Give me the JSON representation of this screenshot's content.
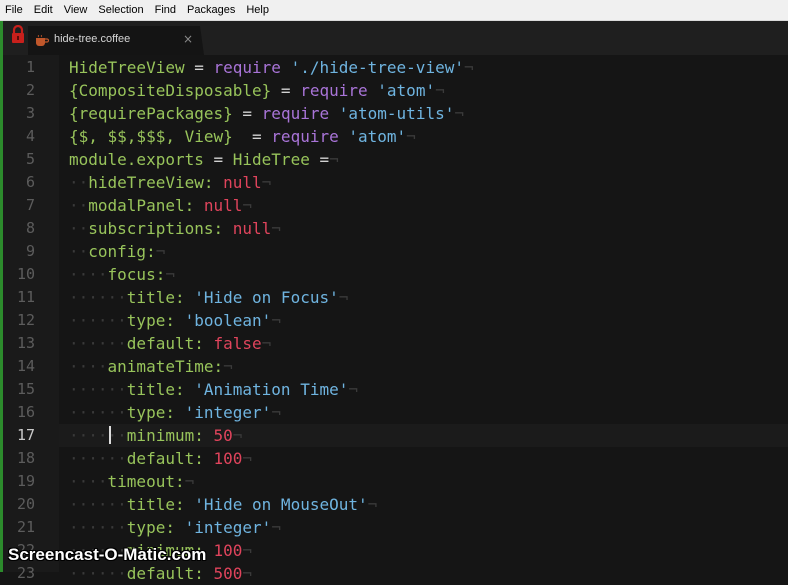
{
  "menubar": {
    "items": [
      "File",
      "Edit",
      "View",
      "Selection",
      "Find",
      "Packages",
      "Help"
    ]
  },
  "tab": {
    "title": "hide-tree.coffee",
    "close_glyph": "×",
    "icon": "coffee-file-icon"
  },
  "editor": {
    "active_line": 17,
    "eol_glyph": "¬",
    "ws_glyph": "·",
    "lines": [
      {
        "n": 1,
        "tokens": [
          [
            "t-var",
            "HideTreeView"
          ],
          [
            "t-plain",
            " = "
          ],
          [
            "t-kw",
            "require"
          ],
          [
            "t-plain",
            " "
          ],
          [
            "t-str",
            "'./hide-tree-view'"
          ]
        ]
      },
      {
        "n": 2,
        "tokens": [
          [
            "t-var",
            "{CompositeDisposable}"
          ],
          [
            "t-plain",
            " = "
          ],
          [
            "t-kw",
            "require"
          ],
          [
            "t-plain",
            " "
          ],
          [
            "t-str",
            "'atom'"
          ]
        ]
      },
      {
        "n": 3,
        "tokens": [
          [
            "t-var",
            "{requirePackages}"
          ],
          [
            "t-plain",
            " = "
          ],
          [
            "t-kw",
            "require"
          ],
          [
            "t-plain",
            " "
          ],
          [
            "t-str",
            "'atom-utils'"
          ]
        ]
      },
      {
        "n": 4,
        "tokens": [
          [
            "t-var",
            "{$, $$,$$$, View}"
          ],
          [
            "t-plain",
            "  = "
          ],
          [
            "t-kw",
            "require"
          ],
          [
            "t-plain",
            " "
          ],
          [
            "t-str",
            "'atom'"
          ]
        ]
      },
      {
        "n": 5,
        "tokens": [
          [
            "t-var",
            "module.exports"
          ],
          [
            "t-plain",
            " = "
          ],
          [
            "t-var",
            "HideTree"
          ],
          [
            "t-plain",
            " ="
          ]
        ]
      },
      {
        "n": 6,
        "indent": 1,
        "tokens": [
          [
            "t-var",
            "hideTreeView:"
          ],
          [
            "t-plain",
            " "
          ],
          [
            "t-null",
            "null"
          ]
        ]
      },
      {
        "n": 7,
        "indent": 1,
        "tokens": [
          [
            "t-var",
            "modalPanel:"
          ],
          [
            "t-plain",
            " "
          ],
          [
            "t-null",
            "null"
          ]
        ]
      },
      {
        "n": 8,
        "indent": 1,
        "tokens": [
          [
            "t-var",
            "subscriptions:"
          ],
          [
            "t-plain",
            " "
          ],
          [
            "t-null",
            "null"
          ]
        ]
      },
      {
        "n": 9,
        "indent": 1,
        "tokens": [
          [
            "t-var",
            "config:"
          ]
        ]
      },
      {
        "n": 10,
        "indent": 2,
        "tokens": [
          [
            "t-var",
            "focus:"
          ]
        ]
      },
      {
        "n": 11,
        "indent": 3,
        "tokens": [
          [
            "t-var",
            "title:"
          ],
          [
            "t-plain",
            " "
          ],
          [
            "t-str",
            "'Hide on Focus'"
          ]
        ]
      },
      {
        "n": 12,
        "indent": 3,
        "tokens": [
          [
            "t-var",
            "type:"
          ],
          [
            "t-plain",
            " "
          ],
          [
            "t-str",
            "'boolean'"
          ]
        ]
      },
      {
        "n": 13,
        "indent": 3,
        "tokens": [
          [
            "t-var",
            "default:"
          ],
          [
            "t-plain",
            " "
          ],
          [
            "t-null",
            "false"
          ]
        ]
      },
      {
        "n": 14,
        "indent": 2,
        "tokens": [
          [
            "t-var",
            "animateTime:"
          ]
        ]
      },
      {
        "n": 15,
        "indent": 3,
        "tokens": [
          [
            "t-var",
            "title:"
          ],
          [
            "t-plain",
            " "
          ],
          [
            "t-str",
            "'Animation Time'"
          ]
        ]
      },
      {
        "n": 16,
        "indent": 3,
        "tokens": [
          [
            "t-var",
            "type:"
          ],
          [
            "t-plain",
            " "
          ],
          [
            "t-str",
            "'integer'"
          ]
        ]
      },
      {
        "n": 17,
        "indent": 3,
        "cursor": true,
        "tokens": [
          [
            "t-var",
            "minimum:"
          ],
          [
            "t-plain",
            " "
          ],
          [
            "t-num",
            "50"
          ]
        ]
      },
      {
        "n": 18,
        "indent": 3,
        "tokens": [
          [
            "t-var",
            "default:"
          ],
          [
            "t-plain",
            " "
          ],
          [
            "t-num",
            "100"
          ]
        ]
      },
      {
        "n": 19,
        "indent": 2,
        "tokens": [
          [
            "t-var",
            "timeout:"
          ]
        ]
      },
      {
        "n": 20,
        "indent": 3,
        "tokens": [
          [
            "t-var",
            "title:"
          ],
          [
            "t-plain",
            " "
          ],
          [
            "t-str",
            "'Hide on MouseOut'"
          ]
        ]
      },
      {
        "n": 21,
        "indent": 3,
        "tokens": [
          [
            "t-var",
            "type:"
          ],
          [
            "t-plain",
            " "
          ],
          [
            "t-str",
            "'integer'"
          ]
        ]
      },
      {
        "n": 22,
        "indent": 3,
        "tokens": [
          [
            "t-var",
            "minimum:"
          ],
          [
            "t-plain",
            " "
          ],
          [
            "t-num",
            "100"
          ]
        ]
      },
      {
        "n": 23,
        "indent": 3,
        "tokens": [
          [
            "t-var",
            "default:"
          ],
          [
            "t-plain",
            " "
          ],
          [
            "t-num",
            "500"
          ]
        ]
      }
    ]
  },
  "watermark": "Screencast-O-Matic.com"
}
